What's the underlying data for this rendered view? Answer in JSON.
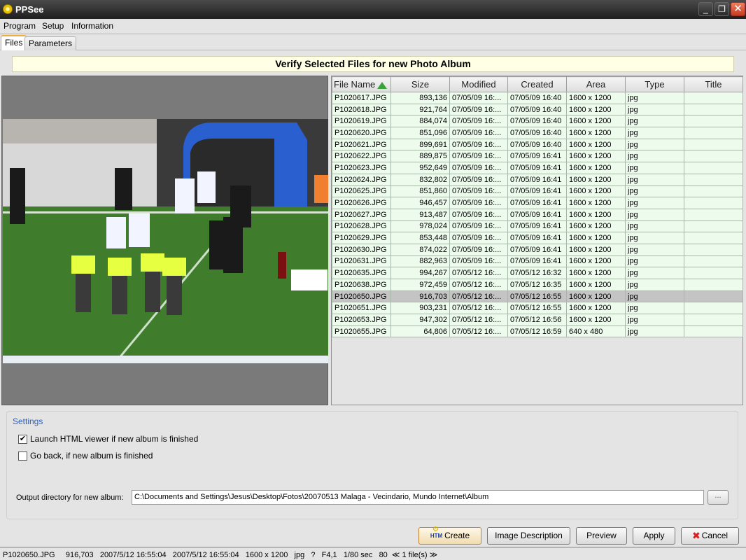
{
  "window": {
    "title": "PPSee",
    "minimize": "_",
    "maximize": "❐",
    "close": "✕"
  },
  "menu": [
    "Program",
    "Setup",
    "Information"
  ],
  "tabs": [
    "Files",
    "Parameters"
  ],
  "banner": "Verify Selected Files for new Photo Album",
  "table": {
    "columns": [
      "File Name",
      "Size",
      "Modified",
      "Created",
      "Area",
      "Type",
      "Title"
    ],
    "sort_column": "File Name",
    "sort_direction": "ascending",
    "selected_index": 18,
    "rows": [
      [
        "P1020617.JPG",
        "893,136",
        "07/05/09 16:...",
        "07/05/09 16:40",
        "1600 x 1200",
        "jpg",
        ""
      ],
      [
        "P1020618.JPG",
        "921,764",
        "07/05/09 16:...",
        "07/05/09 16:40",
        "1600 x 1200",
        "jpg",
        ""
      ],
      [
        "P1020619.JPG",
        "884,074",
        "07/05/09 16:...",
        "07/05/09 16:40",
        "1600 x 1200",
        "jpg",
        ""
      ],
      [
        "P1020620.JPG",
        "851,096",
        "07/05/09 16:...",
        "07/05/09 16:40",
        "1600 x 1200",
        "jpg",
        ""
      ],
      [
        "P1020621.JPG",
        "899,691",
        "07/05/09 16:...",
        "07/05/09 16:40",
        "1600 x 1200",
        "jpg",
        ""
      ],
      [
        "P1020622.JPG",
        "889,875",
        "07/05/09 16:...",
        "07/05/09 16:41",
        "1600 x 1200",
        "jpg",
        ""
      ],
      [
        "P1020623.JPG",
        "952,649",
        "07/05/09 16:...",
        "07/05/09 16:41",
        "1600 x 1200",
        "jpg",
        ""
      ],
      [
        "P1020624.JPG",
        "832,802",
        "07/05/09 16:...",
        "07/05/09 16:41",
        "1600 x 1200",
        "jpg",
        ""
      ],
      [
        "P1020625.JPG",
        "851,860",
        "07/05/09 16:...",
        "07/05/09 16:41",
        "1600 x 1200",
        "jpg",
        ""
      ],
      [
        "P1020626.JPG",
        "946,457",
        "07/05/09 16:...",
        "07/05/09 16:41",
        "1600 x 1200",
        "jpg",
        ""
      ],
      [
        "P1020627.JPG",
        "913,487",
        "07/05/09 16:...",
        "07/05/09 16:41",
        "1600 x 1200",
        "jpg",
        ""
      ],
      [
        "P1020628.JPG",
        "978,024",
        "07/05/09 16:...",
        "07/05/09 16:41",
        "1600 x 1200",
        "jpg",
        ""
      ],
      [
        "P1020629.JPG",
        "853,448",
        "07/05/09 16:...",
        "07/05/09 16:41",
        "1600 x 1200",
        "jpg",
        ""
      ],
      [
        "P1020630.JPG",
        "874,022",
        "07/05/09 16:...",
        "07/05/09 16:41",
        "1600 x 1200",
        "jpg",
        ""
      ],
      [
        "P1020631.JPG",
        "882,963",
        "07/05/09 16:...",
        "07/05/09 16:41",
        "1600 x 1200",
        "jpg",
        ""
      ],
      [
        "P1020635.JPG",
        "994,267",
        "07/05/12 16:...",
        "07/05/12 16:32",
        "1600 x 1200",
        "jpg",
        ""
      ],
      [
        "P1020638.JPG",
        "972,459",
        "07/05/12 16:...",
        "07/05/12 16:35",
        "1600 x 1200",
        "jpg",
        ""
      ],
      [
        "P1020650.JPG",
        "916,703",
        "07/05/12 16:...",
        "07/05/12 16:55",
        "1600 x 1200",
        "jpg",
        ""
      ],
      [
        "P1020651.JPG",
        "903,231",
        "07/05/12 16:...",
        "07/05/12 16:55",
        "1600 x 1200",
        "jpg",
        ""
      ],
      [
        "P1020653.JPG",
        "947,302",
        "07/05/12 16:...",
        "07/05/12 16:56",
        "1600 x 1200",
        "jpg",
        ""
      ],
      [
        "P1020655.JPG",
        "64,806",
        "07/05/12 16:...",
        "07/05/12 16:59",
        "640 x 480",
        "jpg",
        ""
      ]
    ]
  },
  "settings": {
    "legend": "Settings",
    "launch_viewer": {
      "label": "Launch HTML viewer if new album is finished",
      "checked": true
    },
    "go_back": {
      "label": "Go back, if new album is finished",
      "checked": false
    },
    "output_label": "Output directory for new album:",
    "output_value": "C:\\Documents and Settings\\Jesus\\Desktop\\Fotos\\20070513 Malaga - Vecindario, Mundo Internet\\Album",
    "browse_label": "..."
  },
  "buttons": {
    "create": "Create",
    "image_description": "Image Description",
    "preview": "Preview",
    "apply": "Apply",
    "cancel": "Cancel",
    "create_icon_text": "HTM"
  },
  "status": {
    "text": "P1020650.JPG     916,703   2007/5/12 16:55:04   2007/5/12 16:55:04   1600 x 1200   jpg   ?   F4,1   1/80 sec   80  ≪ 1 file(s) ≫"
  }
}
